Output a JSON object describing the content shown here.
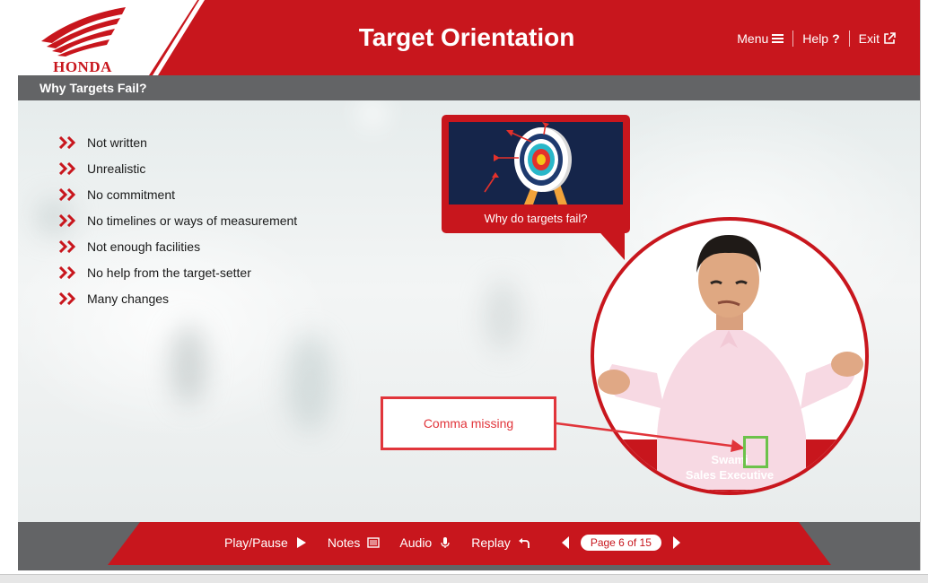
{
  "header": {
    "brand": "HONDA",
    "title": "Target Orientation",
    "nav": [
      {
        "label": "Menu",
        "icon": "hamburger-icon"
      },
      {
        "label": "Help",
        "icon": "question-icon"
      },
      {
        "label": "Exit",
        "icon": "external-link-icon"
      }
    ]
  },
  "page": {
    "title": "Why Targets Fail?",
    "bullets": [
      "Not written",
      "Unrealistic",
      "No commitment",
      "No timelines or ways of measurement",
      "Not enough facilities",
      "No help from the target-setter",
      "Many changes"
    ]
  },
  "video": {
    "caption": "Why do targets fail?",
    "icon": "target-dartboard-icon"
  },
  "character": {
    "name": "Swami",
    "role": "Sales Executive"
  },
  "annotation": {
    "text": "Comma missing"
  },
  "footer": {
    "play_pause": "Play/Pause",
    "notes": "Notes",
    "audio": "Audio",
    "replay": "Replay",
    "page_indicator": "Page 6 of 15"
  },
  "colors": {
    "brand_red": "#c8161d",
    "bar_gray": "#636466",
    "annotation_red": "#e1353b",
    "highlight_green": "#6cc24a"
  }
}
